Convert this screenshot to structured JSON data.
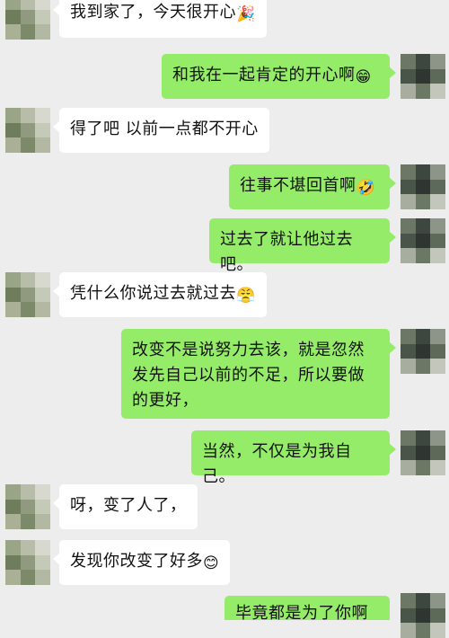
{
  "colors": {
    "background": "#ededed",
    "incoming_bubble": "#ffffff",
    "outgoing_bubble": "#95ec69"
  },
  "messages": [
    {
      "side": "left",
      "text": "我到家了，今天很开心",
      "emoji": "🎉",
      "emoji_name": "party-popper-icon"
    },
    {
      "side": "right",
      "text": "和我在一起肯定的开心啊",
      "emoji": "😁",
      "emoji_name": "grin-icon"
    },
    {
      "side": "left",
      "text": "得了吧 以前一点都不开心",
      "emoji": "",
      "emoji_name": ""
    },
    {
      "side": "right",
      "text": "往事不堪回首啊",
      "emoji": "🤣",
      "emoji_name": "rofl-icon"
    },
    {
      "side": "right",
      "text": "过去了就让他过去吧。",
      "emoji": "",
      "emoji_name": ""
    },
    {
      "side": "left",
      "text": "凭什么你说过去就过去",
      "emoji": "😤",
      "emoji_name": "huff-icon"
    },
    {
      "side": "right",
      "text": "改变不是说努力去该，就是忽然发先自己以前的不足，所以要做的更好，",
      "emoji": "",
      "emoji_name": ""
    },
    {
      "side": "right",
      "text": "当然，不仅是为我自己。",
      "emoji": "",
      "emoji_name": ""
    },
    {
      "side": "left",
      "text": "呀，变了人了，",
      "emoji": "",
      "emoji_name": ""
    },
    {
      "side": "left",
      "text": "发现你改变了好多",
      "emoji": "😊",
      "emoji_name": "smile-icon"
    },
    {
      "side": "right",
      "text": "毕竟都是为了你啊",
      "emoji": "",
      "emoji_name": ""
    }
  ]
}
